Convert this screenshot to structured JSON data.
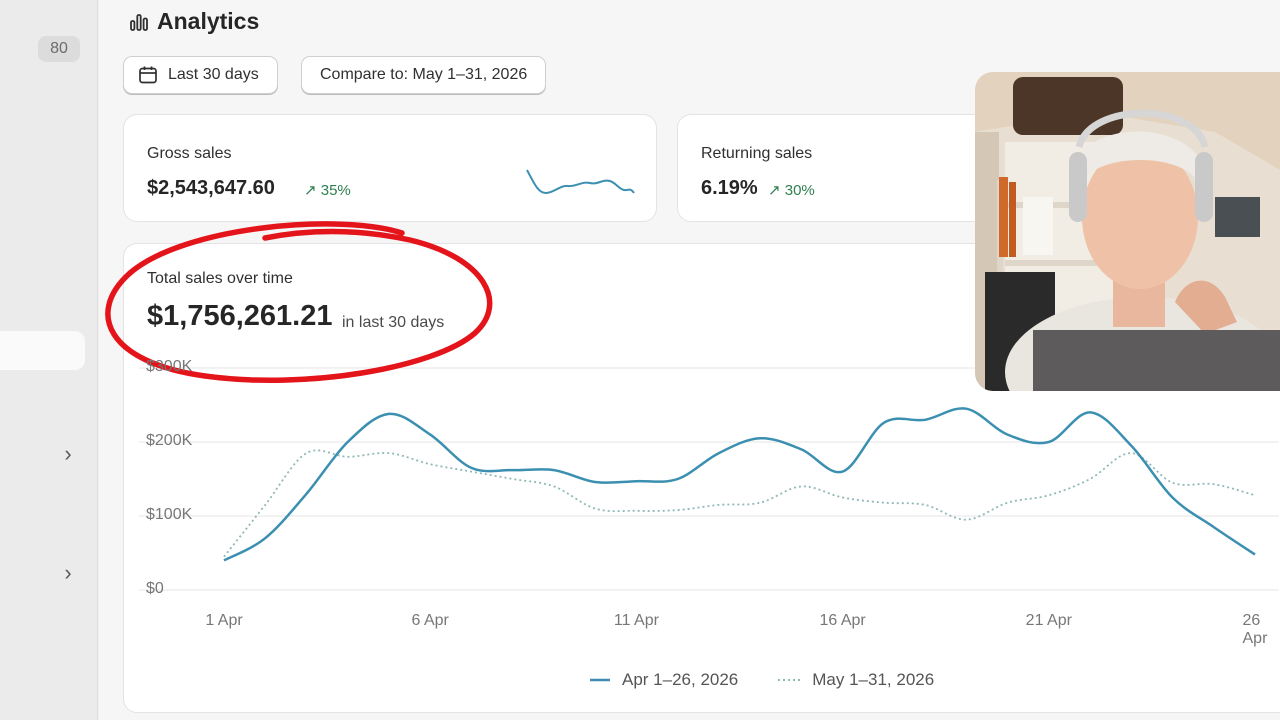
{
  "sidebar": {
    "badge_count": "80"
  },
  "header": {
    "title": "Analytics"
  },
  "filters": {
    "date_range": "Last 30 days",
    "compare": "Compare to: May 1–31, 2026"
  },
  "cards": {
    "gross": {
      "label": "Gross sales",
      "value": "$2,543,647.60",
      "trend": "35%"
    },
    "returning": {
      "label": "Returning sales",
      "value": "6.19%",
      "trend": "30%"
    }
  },
  "total_sales": {
    "label": "Total sales over time",
    "value": "$1,756,261.21",
    "suffix": "in last 30 days"
  },
  "colors": {
    "primary_series": "#3b8fb0",
    "comparison_series": "#8fb8b7",
    "annotation": "#e4141b",
    "trend_positive": "#2f7f50"
  },
  "chart_data": {
    "type": "line",
    "x": [
      "1 Apr",
      "2 Apr",
      "3 Apr",
      "4 Apr",
      "5 Apr",
      "6 Apr",
      "7 Apr",
      "8 Apr",
      "9 Apr",
      "10 Apr",
      "11 Apr",
      "12 Apr",
      "13 Apr",
      "14 Apr",
      "15 Apr",
      "16 Apr",
      "17 Apr",
      "18 Apr",
      "19 Apr",
      "20 Apr",
      "21 Apr",
      "22 Apr",
      "23 Apr",
      "24 Apr",
      "25 Apr",
      "26 Apr"
    ],
    "x_ticks": [
      "1 Apr",
      "6 Apr",
      "11 Apr",
      "16 Apr",
      "21 Apr",
      "26 Apr"
    ],
    "y_ticks": [
      "$0",
      "$100K",
      "$200K",
      "$300K"
    ],
    "ylim": [
      0,
      300000
    ],
    "grid": true,
    "series": [
      {
        "name": "Apr 1–26, 2026",
        "style": "solid",
        "values": [
          40000,
          70000,
          130000,
          200000,
          238000,
          210000,
          165000,
          162000,
          162000,
          146000,
          147000,
          150000,
          185000,
          205000,
          190000,
          160000,
          226000,
          230000,
          245000,
          210000,
          200000,
          240000,
          195000,
          125000,
          85000,
          48000
        ]
      },
      {
        "name": "May 1–31, 2026",
        "style": "dotted",
        "values": [
          45000,
          115000,
          185000,
          180000,
          185000,
          170000,
          160000,
          150000,
          140000,
          110000,
          107000,
          108000,
          115000,
          118000,
          140000,
          125000,
          118000,
          115000,
          95000,
          118000,
          128000,
          150000,
          185000,
          145000,
          143000,
          128000
        ]
      }
    ]
  }
}
